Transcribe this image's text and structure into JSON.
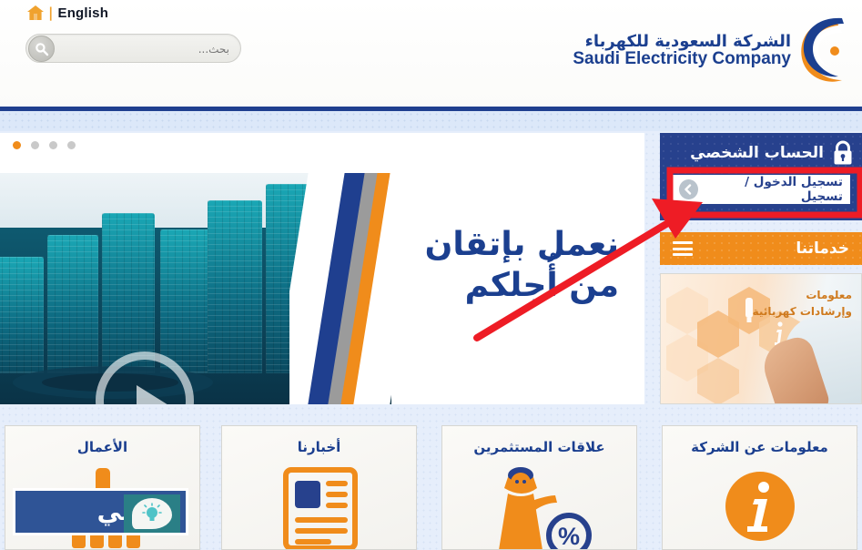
{
  "header": {
    "language_link": "English",
    "separator": "|",
    "home_icon": "home-icon",
    "search": {
      "placeholder": "بحث...",
      "value": "",
      "icon": "search-icon"
    },
    "logo": {
      "arabic": "الشركة السعودية للكهرباء",
      "english": "Saudi Electricity Company",
      "mark_colors": {
        "blue": "#1b3f8f",
        "orange": "#f08c1b"
      }
    }
  },
  "hero": {
    "carousel_dots": [
      {
        "active": false
      },
      {
        "active": false
      },
      {
        "active": false
      },
      {
        "active": true
      }
    ],
    "play_button": "play-icon",
    "headline_line1": "نعمل بإتقان",
    "headline_line2": "من أُجلكم",
    "headline_color": "#1b3f8f",
    "stripe_colors": [
      "#1f3f8f",
      "#9b9b9b",
      "#f08c1b"
    ]
  },
  "sidebar": {
    "account": {
      "title": "الحساب الشخصي",
      "icon": "lock-icon",
      "bg_color": "#27418d",
      "login_button": {
        "label": "تسجيل الدخول / تسجيل",
        "icon": "chevron-left-icon"
      }
    },
    "services": {
      "label": "خدماتنا",
      "icon": "hamburger-icon",
      "bg_color": "#f08c1b"
    },
    "promo": {
      "title_line1": "معلومات",
      "title_line2": "وإرشادات كهربائية",
      "icon": "info-icon"
    }
  },
  "cards": [
    {
      "title": "الأعمال",
      "icon": "lightbulb-chart-icon"
    },
    {
      "title": "أخبارنا",
      "icon": "newspaper-icon"
    },
    {
      "title": "علاقات المستثمرين",
      "icon": "investor-person-percent-icon"
    },
    {
      "title": "معلومات عن الشركة",
      "icon": "info-circle-icon"
    }
  ],
  "watermark": {
    "text": "ثقفني",
    "icon": "speech-bubble-lightbulb-icon",
    "box_color": "#2f5496",
    "bubble_color": "#2a7f86"
  },
  "annotation": {
    "highlight_box_color": "#ee1c25",
    "arrow_color": "#ee1c25",
    "arrow_from": "522,372",
    "arrow_to": "762,228",
    "target": "login-button"
  }
}
